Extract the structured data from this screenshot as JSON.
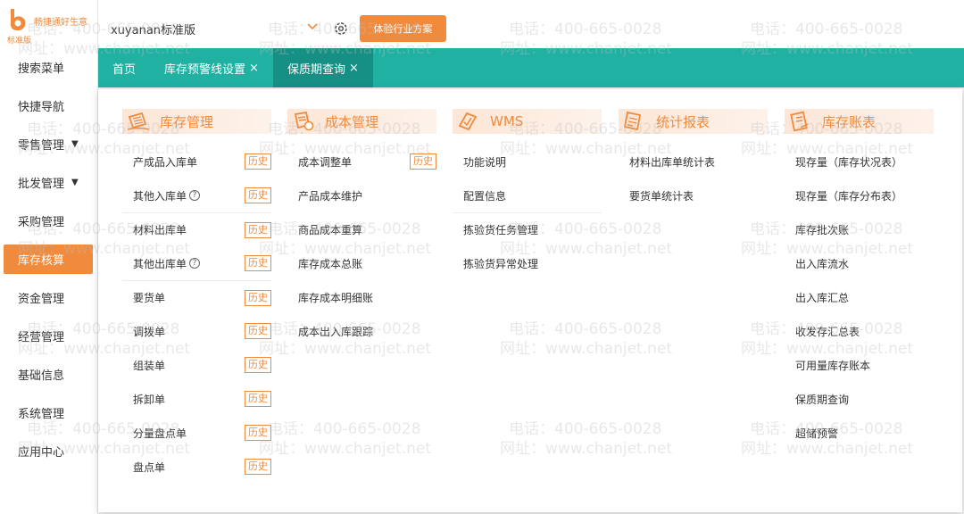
{
  "logo": {
    "text": "畅捷通好生意",
    "sub": "标准版"
  },
  "sidebar": {
    "items": [
      {
        "label": "搜索菜单",
        "caret": false
      },
      {
        "label": "快捷导航",
        "caret": false
      },
      {
        "label": "零售管理",
        "caret": true
      },
      {
        "label": "批发管理",
        "caret": true
      },
      {
        "label": "采购管理",
        "caret": false
      },
      {
        "label": "库存核算",
        "caret": false,
        "active": true
      },
      {
        "label": "资金管理",
        "caret": false
      },
      {
        "label": "经营管理",
        "caret": false
      },
      {
        "label": "基础信息",
        "caret": false
      },
      {
        "label": "系统管理",
        "caret": false
      },
      {
        "label": "应用中心",
        "caret": false
      }
    ]
  },
  "topbar": {
    "account": "xuyanan标准版",
    "trial_button": "体验行业方案"
  },
  "tabs": [
    {
      "label": "首页",
      "closable": false
    },
    {
      "label": "库存预警线设置",
      "closable": true
    },
    {
      "label": "保质期查询",
      "closable": true,
      "active": true
    }
  ],
  "close_glyph": "×",
  "history_label": "历史",
  "help_glyph": "?",
  "columns": [
    {
      "title": "库存管理",
      "icon": "inventory-icon",
      "items": [
        {
          "label": "产成品入库单",
          "history": true
        },
        {
          "label": "其他入库单",
          "history": true,
          "help": true
        },
        {
          "label": "材料出库单",
          "history": true,
          "sep": true
        },
        {
          "label": "其他出库单",
          "history": true,
          "help": true
        },
        {
          "label": "要货单",
          "history": true,
          "sep": true
        },
        {
          "label": "调拨单",
          "history": true
        },
        {
          "label": "组装单",
          "history": true
        },
        {
          "label": "拆卸单",
          "history": true
        },
        {
          "label": "分量盘点单",
          "history": true
        },
        {
          "label": "盘点单",
          "history": true
        }
      ]
    },
    {
      "title": "成本管理",
      "icon": "cost-icon",
      "items": [
        {
          "label": "成本调整单",
          "history": true
        },
        {
          "label": "产品成本维护"
        },
        {
          "label": "商品成本重算"
        },
        {
          "label": "库存成本总账"
        },
        {
          "label": "库存成本明细账"
        },
        {
          "label": "成本出入库跟踪"
        }
      ]
    },
    {
      "title": "WMS",
      "icon": "wms-icon",
      "items": [
        {
          "label": "功能说明"
        },
        {
          "label": "配置信息"
        },
        {
          "label": "拣验货任务管理",
          "sep": true
        },
        {
          "label": "拣验货异常处理"
        }
      ]
    },
    {
      "title": "统计报表",
      "icon": "report-icon",
      "items": [
        {
          "label": "材料出库单统计表"
        },
        {
          "label": "要货单统计表"
        }
      ]
    },
    {
      "title": "库存账表",
      "icon": "ledger-icon",
      "items": [
        {
          "label": "现存量（库存状况表）"
        },
        {
          "label": "现存量（库存分布表）"
        },
        {
          "label": "库存批次账"
        },
        {
          "label": "出入库流水"
        },
        {
          "label": "出入库汇总"
        },
        {
          "label": "收发存汇总表"
        },
        {
          "label": "可用量库存账本"
        },
        {
          "label": "保质期查询"
        },
        {
          "label": "超储预警"
        }
      ]
    }
  ],
  "watermark": {
    "phone": "电话：400-665-0028",
    "site": "网址：www.chanjet.net"
  },
  "colors": {
    "accent": "#f08a3c",
    "teal": "#20b1a3",
    "teal_active": "#168f84"
  }
}
